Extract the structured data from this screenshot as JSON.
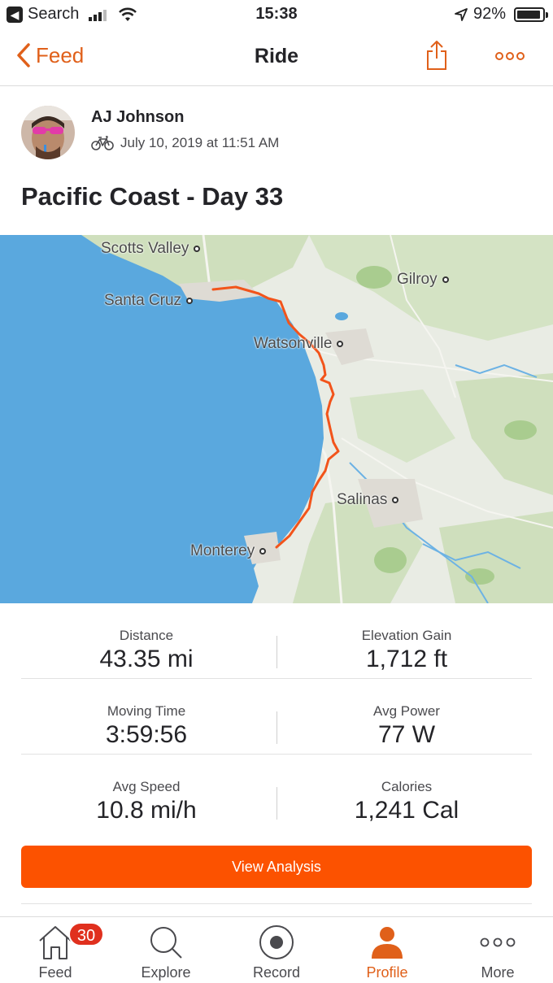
{
  "status_bar": {
    "back_app": "Search",
    "time": "15:38",
    "battery": "92%",
    "battery_level": 0.92
  },
  "nav": {
    "back_label": "Feed",
    "title": "Ride"
  },
  "activity": {
    "athlete_name": "AJ Johnson",
    "datetime": "July 10, 2019 at 11:51 AM",
    "title": "Pacific Coast - Day 33"
  },
  "map": {
    "places": {
      "scotts_valley": "Scotts Valley",
      "santa_cruz": "Santa Cruz",
      "gilroy": "Gilroy",
      "watsonville": "Watsonville",
      "salinas": "Salinas",
      "monterey": "Monterey"
    },
    "colors": {
      "water": "#5aa8de",
      "land": "#e9ece4",
      "green": "#c8ddb4",
      "route": "#f2541b"
    }
  },
  "stats": {
    "distance": {
      "label": "Distance",
      "value": "43.35 mi"
    },
    "elevation": {
      "label": "Elevation Gain",
      "value": "1,712 ft"
    },
    "moving_time": {
      "label": "Moving Time",
      "value": "3:59:56"
    },
    "avg_power": {
      "label": "Avg Power",
      "value": "77 W"
    },
    "avg_speed": {
      "label": "Avg Speed",
      "value": "10.8 mi/h"
    },
    "calories": {
      "label": "Calories",
      "value": "1,241 Cal"
    }
  },
  "view_analysis_label": "View Analysis",
  "tabs": {
    "feed": "Feed",
    "explore": "Explore",
    "record": "Record",
    "profile": "Profile",
    "more": "More",
    "feed_badge": "30"
  },
  "colors": {
    "accent": "#fc5200",
    "badge": "#e0301e"
  }
}
